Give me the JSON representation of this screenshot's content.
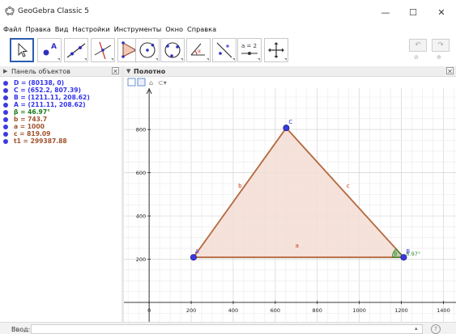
{
  "window": {
    "title": "GeoGebra Classic 5",
    "minimize": "—",
    "maximize": "☐",
    "close": "✕"
  },
  "menu": [
    "Файл",
    "Правка",
    "Вид",
    "Настройки",
    "Инструменты",
    "Окно",
    "Справка"
  ],
  "toolbar": {
    "tools": [
      "move",
      "point",
      "line",
      "perpendicular-line",
      "polygon",
      "circle",
      "conic",
      "angle",
      "reflect",
      "slider",
      "move-graphics"
    ],
    "slider_label": "a = 2",
    "undo": "↶",
    "redo": "↷"
  },
  "algebra": {
    "title": "Панель объектов",
    "items": [
      {
        "text": "D = (80138, 0)",
        "color": "#3333ee"
      },
      {
        "text": "C = (652.2, 807.39)",
        "color": "#3333ee"
      },
      {
        "text": "B = (1211.11, 208.62)",
        "color": "#3333ee"
      },
      {
        "text": "A = (211.11, 208.62)",
        "color": "#3333ee"
      },
      {
        "text": "β = 46.97°",
        "color": "#1a7a1a"
      },
      {
        "text": "b = 743.7",
        "color": "#a0522d"
      },
      {
        "text": "a = 1000",
        "color": "#a0522d"
      },
      {
        "text": "c = 819.09",
        "color": "#a0522d"
      },
      {
        "text": "t1 = 299387.88",
        "color": "#a0522d"
      }
    ]
  },
  "graphics": {
    "title": "Полотно",
    "point_labels": {
      "A": "A",
      "B": "B",
      "C": "C"
    },
    "side_labels": {
      "a": "a",
      "b": "b",
      "c": "c"
    },
    "angle_label": "6.97°",
    "angle_prefix": "β",
    "colors": {
      "polygon_fill": "#f3ddd3",
      "polygon_stroke": "#b5683c",
      "point": "#3a3adf",
      "angle": "#2b8a2b",
      "side_label": "#cc3300"
    }
  },
  "chart_data": {
    "type": "scatter",
    "xlim": [
      -120,
      1460
    ],
    "ylim": [
      -90,
      1040
    ],
    "x_ticks": [
      0,
      200,
      400,
      600,
      800,
      1000,
      1200,
      1400
    ],
    "y_ticks": [
      200,
      400,
      600,
      800,
      1000
    ],
    "grid": true,
    "points": [
      {
        "name": "A",
        "x": 211.11,
        "y": 208.62
      },
      {
        "name": "B",
        "x": 1211.11,
        "y": 208.62
      },
      {
        "name": "C",
        "x": 652.2,
        "y": 807.39
      }
    ]
  },
  "input": {
    "label": "Ввод:",
    "value": "",
    "spin": "▴",
    "help": "?"
  }
}
